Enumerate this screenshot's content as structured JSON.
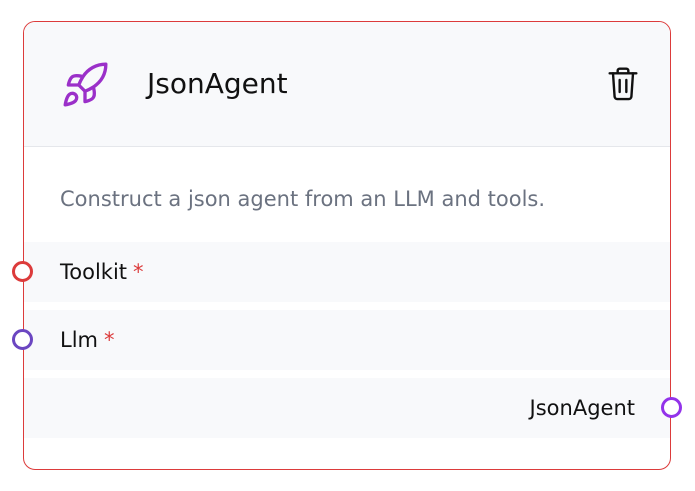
{
  "node": {
    "title": "JsonAgent",
    "description": "Construct a json agent from an LLM and tools.",
    "icon": "rocket-icon",
    "delete_icon": "trash-icon",
    "accent_color": "#9b30c9",
    "border_color": "#dc3b3b"
  },
  "fields": [
    {
      "label": "Toolkit",
      "required_mark": "*",
      "handle_color": "#dc3b3b"
    },
    {
      "label": "Llm",
      "required_mark": "*",
      "handle_color": "#6b46c1"
    }
  ],
  "output": {
    "label": "JsonAgent",
    "handle_color": "#9333ea"
  }
}
